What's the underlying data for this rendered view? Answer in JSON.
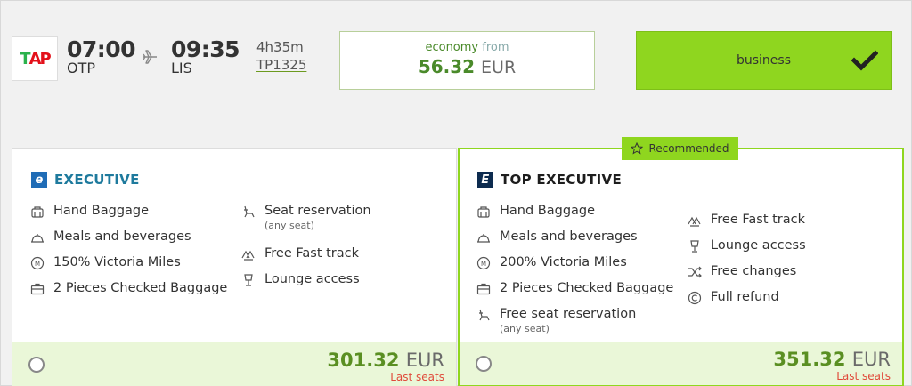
{
  "flight": {
    "airline_logo": "TAP",
    "depart_time": "07:00",
    "depart_code": "OTP",
    "arrive_time": "09:35",
    "arrive_code": "LIS",
    "duration": "4h35m",
    "flight_number": "TP1325"
  },
  "fares": {
    "economy": {
      "label": "economy",
      "from_label": "from",
      "price": "56.32",
      "currency": "EUR"
    },
    "business": {
      "label": "business",
      "selected": true
    }
  },
  "cards": [
    {
      "title": "EXECUTIVE",
      "badge_letter": "e",
      "features_left": [
        {
          "icon": "hand-baggage-icon",
          "label": "Hand Baggage"
        },
        {
          "icon": "meals-icon",
          "label": "Meals and beverages"
        },
        {
          "icon": "miles-icon",
          "label": "150% Victoria Miles"
        },
        {
          "icon": "checked-baggage-icon",
          "label": "2 Pieces Checked Baggage"
        }
      ],
      "features_right": [
        {
          "icon": "seat-icon",
          "label": "Seat reservation",
          "sub": "(any seat)"
        },
        {
          "icon": "fast-track-icon",
          "label": "Free Fast track"
        },
        {
          "icon": "lounge-icon",
          "label": "Lounge access"
        }
      ],
      "price": "301.32",
      "currency": "EUR",
      "availability": "Last seats"
    },
    {
      "title": "TOP EXECUTIVE",
      "badge_letter": "E",
      "recommended_label": "Recommended",
      "features_left": [
        {
          "icon": "hand-baggage-icon",
          "label": "Hand Baggage"
        },
        {
          "icon": "meals-icon",
          "label": "Meals and beverages"
        },
        {
          "icon": "miles-icon",
          "label": "200% Victoria Miles"
        },
        {
          "icon": "checked-baggage-icon",
          "label": "2 Pieces Checked Baggage"
        },
        {
          "icon": "seat-icon",
          "label": "Free seat reservation",
          "sub": "(any seat)"
        }
      ],
      "features_right": [
        {
          "icon": "fast-track-icon",
          "label": "Free Fast track"
        },
        {
          "icon": "lounge-icon",
          "label": "Lounge access"
        },
        {
          "icon": "shuffle-icon",
          "label": "Free changes"
        },
        {
          "icon": "copyright-icon",
          "label": "Full refund"
        }
      ],
      "price": "351.32",
      "currency": "EUR",
      "availability": "Last seats"
    }
  ],
  "colors": {
    "accent": "#8fd61f",
    "price": "#5a8f22",
    "warning": "#e04a3a",
    "executive": "#1e7a9d"
  }
}
